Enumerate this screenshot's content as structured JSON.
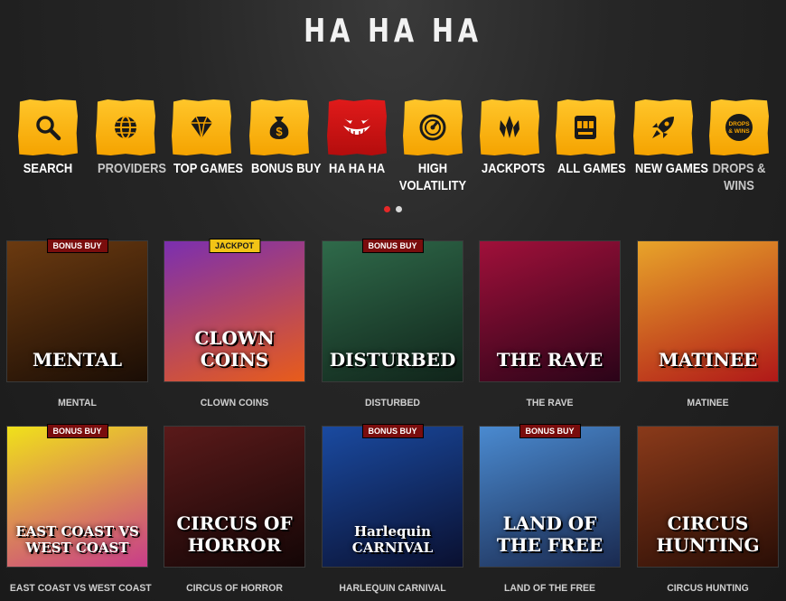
{
  "page_title": "HA HA HA",
  "categories": [
    {
      "label": "SEARCH",
      "icon": "search-icon"
    },
    {
      "label": "PROVIDERS",
      "icon": "globe-icon"
    },
    {
      "label": "TOP GAMES",
      "icon": "diamond-icon"
    },
    {
      "label": "BONUS BUY",
      "icon": "money-bag-icon"
    },
    {
      "label": "HA HA HA",
      "icon": "clown-smile-icon"
    },
    {
      "label": "HIGH VOLATILITY",
      "icon": "gauge-icon"
    },
    {
      "label": "JACKPOTS",
      "icon": "crown-icon"
    },
    {
      "label": "ALL GAMES",
      "icon": "slot-machine-icon"
    },
    {
      "label": "NEW GAMES",
      "icon": "rocket-icon"
    },
    {
      "label": "DROPS & WINS",
      "icon": "drops-and-wins-icon"
    }
  ],
  "drops_icon_text": "DROPS & WINS",
  "carousel_pages": 2,
  "games": [
    {
      "name": "MENTAL",
      "badge": "BONUS BUY",
      "art_text": "MENTAL",
      "bg": [
        "#6b3a10",
        "#1a0d05"
      ]
    },
    {
      "name": "CLOWN COINS",
      "badge": "JACKPOT",
      "art_text": "CLOWN COINS",
      "bg": [
        "#7b2fb0",
        "#e85c1a"
      ]
    },
    {
      "name": "DISTURBED",
      "badge": "BONUS BUY",
      "art_text": "DISTURBED",
      "bg": [
        "#2f6a4a",
        "#10241a"
      ]
    },
    {
      "name": "THE RAVE",
      "badge": "",
      "art_text": "THE RAVE",
      "bg": [
        "#a0103a",
        "#2a0418"
      ]
    },
    {
      "name": "MATINEE",
      "badge": "",
      "art_text": "MATINEE",
      "bg": [
        "#e8a42a",
        "#b01818"
      ]
    },
    {
      "name": "EAST COAST VS WEST COAST",
      "badge": "BONUS BUY",
      "art_text": "EAST COAST VS WEST COAST",
      "bg": [
        "#f0e11a",
        "#c83c8a"
      ]
    },
    {
      "name": "CIRCUS OF HORROR",
      "badge": "",
      "art_text": "CIRCUS OF HORROR",
      "bg": [
        "#5a1a1a",
        "#140606"
      ]
    },
    {
      "name": "HARLEQUIN CARNIVAL",
      "badge": "BONUS BUY",
      "art_text": "Harlequin CARNIVAL",
      "bg": [
        "#1a4aa0",
        "#0a1030"
      ]
    },
    {
      "name": "LAND OF THE FREE",
      "badge": "BONUS BUY",
      "art_text": "LAND OF THE FREE",
      "bg": [
        "#4a8ad0",
        "#1a2a50"
      ]
    },
    {
      "name": "CIRCUS HUNTING",
      "badge": "",
      "art_text": "CIRCUS HUNTING",
      "bg": [
        "#8a3a1a",
        "#2a0e06"
      ]
    }
  ]
}
